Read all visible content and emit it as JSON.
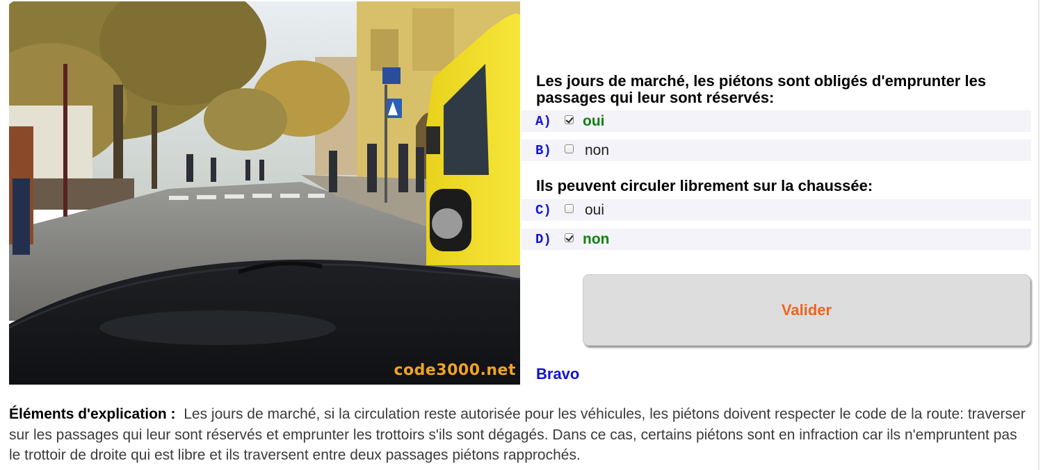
{
  "image": {
    "watermark": "code3000.net"
  },
  "questions": [
    {
      "text": "Les jours de marché, les piétons sont obligés d'emprunter les passages qui leur sont réservés:",
      "options": [
        {
          "letter": "A)",
          "label": "oui",
          "checked": true,
          "correct": true
        },
        {
          "letter": "B)",
          "label": "non",
          "checked": false,
          "correct": false
        }
      ]
    },
    {
      "text": "Ils peuvent circuler librement sur la chaussée:",
      "options": [
        {
          "letter": "C)",
          "label": "oui",
          "checked": false,
          "correct": false
        },
        {
          "letter": "D)",
          "label": "non",
          "checked": true,
          "correct": true
        }
      ]
    }
  ],
  "validate_label": "Valider",
  "result": "Bravo",
  "explanation": {
    "title": "Éléments d'explication :",
    "text": "Les jours de marché, si la circulation reste autorisée pour les véhicules, les piétons doivent respecter le code de la route: traverser sur les passages qui leur sont réservés et emprunter les trottoirs s'ils sont dégagés. Dans ce cas, certains piétons sont en infraction car ils n'empruntent pas le trottoir de droite qui est libre et ils traversent entre deux passages piétons rapprochés."
  },
  "colors": {
    "correct": "#118011",
    "letter": "#1414d6",
    "validate_text": "#f0641c",
    "result": "#1212d0"
  }
}
